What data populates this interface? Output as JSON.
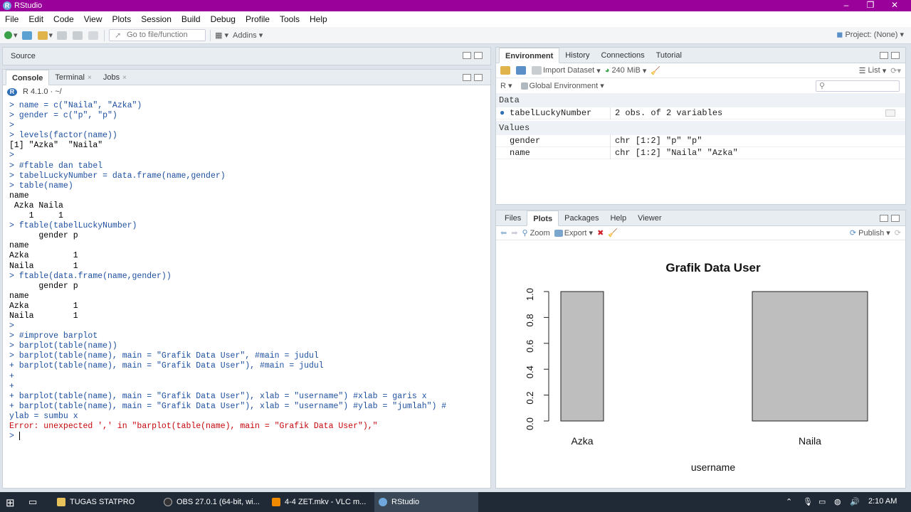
{
  "window": {
    "title": "RStudio"
  },
  "menu": [
    "File",
    "Edit",
    "Code",
    "View",
    "Plots",
    "Session",
    "Build",
    "Debug",
    "Profile",
    "Tools",
    "Help"
  ],
  "toolbar": {
    "goto_placeholder": "Go to file/function",
    "addins": "Addins",
    "project": "Project: (None)"
  },
  "source": {
    "label": "Source"
  },
  "console": {
    "tabs": [
      "Console",
      "Terminal",
      "Jobs"
    ],
    "version": "R 4.1.0 · ~/",
    "lines": [
      {
        "t": "cmd",
        "s": "> name = c(\"Naila\", \"Azka\")"
      },
      {
        "t": "cmd",
        "s": "> gender = c(\"p\", \"p\")"
      },
      {
        "t": "cmd",
        "s": ">"
      },
      {
        "t": "cmd",
        "s": "> levels(factor(name))"
      },
      {
        "t": "out",
        "s": "[1] \"Azka\"  \"Naila\""
      },
      {
        "t": "cmd",
        "s": ">"
      },
      {
        "t": "cmd",
        "s": "> #ftable dan tabel"
      },
      {
        "t": "cmd",
        "s": "> tabelLuckyNumber = data.frame(name,gender)"
      },
      {
        "t": "cmd",
        "s": "> table(name)"
      },
      {
        "t": "out",
        "s": "name"
      },
      {
        "t": "out",
        "s": " Azka Naila"
      },
      {
        "t": "out",
        "s": "    1     1"
      },
      {
        "t": "cmd",
        "s": "> ftable(tabelLuckyNumber)"
      },
      {
        "t": "out",
        "s": "      gender p"
      },
      {
        "t": "out",
        "s": "name"
      },
      {
        "t": "out",
        "s": "Azka         1"
      },
      {
        "t": "out",
        "s": "Naila        1"
      },
      {
        "t": "cmd",
        "s": "> ftable(data.frame(name,gender))"
      },
      {
        "t": "out",
        "s": "      gender p"
      },
      {
        "t": "out",
        "s": "name"
      },
      {
        "t": "out",
        "s": "Azka         1"
      },
      {
        "t": "out",
        "s": "Naila        1"
      },
      {
        "t": "cmd",
        "s": ">"
      },
      {
        "t": "cmd",
        "s": "> #improve barplot"
      },
      {
        "t": "cmd",
        "s": "> barplot(table(name))"
      },
      {
        "t": "cmd",
        "s": "> barplot(table(name), main = \"Grafik Data User\", #main = judul"
      },
      {
        "t": "cmd",
        "s": "+ barplot(table(name), main = \"Grafik Data User\"), #main = judul"
      },
      {
        "t": "cmd",
        "s": "+"
      },
      {
        "t": "cmd",
        "s": "+"
      },
      {
        "t": "cmd",
        "s": "+ barplot(table(name), main = \"Grafik Data User\"), xlab = \"username\") #xlab = garis x"
      },
      {
        "t": "cmd",
        "s": "+ barplot(table(name), main = \"Grafik Data User\"), xlab = \"username\") #ylab = \"jumlah\") #"
      },
      {
        "t": "cmd",
        "s": "ylab = sumbu x"
      },
      {
        "t": "err",
        "s": "Error: unexpected ',' in \"barplot(table(name), main = \"Grafik Data User\"),\""
      },
      {
        "t": "cmd",
        "s": "> "
      }
    ]
  },
  "env": {
    "tabs": [
      "Environment",
      "History",
      "Connections",
      "Tutorial"
    ],
    "import": "Import Dataset",
    "memory": "240 MiB",
    "list": "List",
    "lang": "R",
    "scope": "Global Environment",
    "data_header": "Data",
    "data": [
      {
        "name": "tabelLuckyNumber",
        "value": "2 obs. of 2 variables"
      }
    ],
    "values_header": "Values",
    "values": [
      {
        "name": "gender",
        "value": "chr [1:2] \"p\" \"p\""
      },
      {
        "name": "name",
        "value": "chr [1:2] \"Naila\" \"Azka\""
      }
    ]
  },
  "files": {
    "tabs": [
      "Files",
      "Plots",
      "Packages",
      "Help",
      "Viewer"
    ],
    "zoom": "Zoom",
    "export": "Export",
    "publish": "Publish"
  },
  "chart_data": {
    "type": "bar",
    "title": "Grafik Data User",
    "xlabel": "username",
    "ylabel": "",
    "categories": [
      "Azka",
      "Naila"
    ],
    "values": [
      1,
      1
    ],
    "ylim": [
      0,
      1
    ],
    "yticks": [
      "0.0",
      "0.2",
      "0.4",
      "0.6",
      "0.8",
      "1.0"
    ],
    "bar_color": "#bebebe"
  },
  "taskbar": {
    "items": [
      "TUGAS STATPRO",
      "OBS 27.0.1 (64-bit, wi...",
      "4-4 ZET.mkv - VLC m...",
      "RStudio"
    ],
    "time": "2:10 AM"
  }
}
